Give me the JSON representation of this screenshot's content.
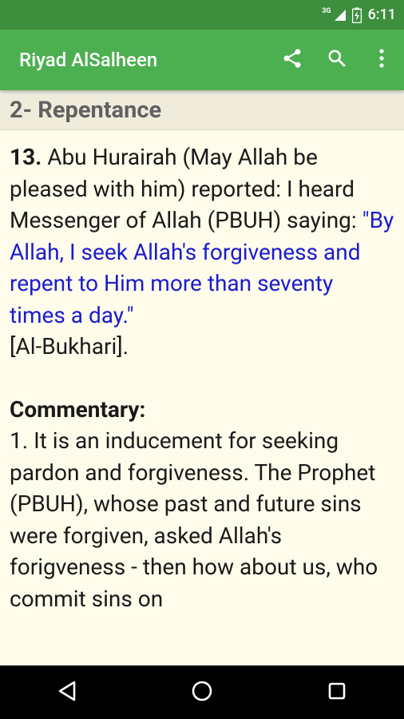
{
  "status": {
    "network": "3G",
    "time": "6:11"
  },
  "appbar": {
    "title": "Riyad AlSalheen",
    "icons": [
      "share-icon",
      "search-icon",
      "more-vert-icon"
    ]
  },
  "section": {
    "title": "2- Repentance"
  },
  "hadith": {
    "number": "13.",
    "intro": " Abu Hurairah (May Allah be pleased with him) reported: I heard Messenger of Allah (PBUH) saying: ",
    "quote": "\"By Allah, I seek Allah's forgiveness and repent to Him more than seventy times a day.\"",
    "source": "[Al-Bukhari]."
  },
  "commentary": {
    "heading": "Commentary:",
    "text": "1. It is an inducement for seeking pardon and forgiveness. The Prophet (PBUH), whose past and future sins were forgiven, asked Allah's forigveness - then how about us, who commit sins on"
  },
  "navbar": {
    "icons": [
      "back-icon",
      "home-icon",
      "recents-icon"
    ]
  },
  "colors": {
    "statusbar": "#3d8f3e",
    "appbar": "#4caf50",
    "content_bg": "#fffceb",
    "quote": "#1a1ccf"
  }
}
